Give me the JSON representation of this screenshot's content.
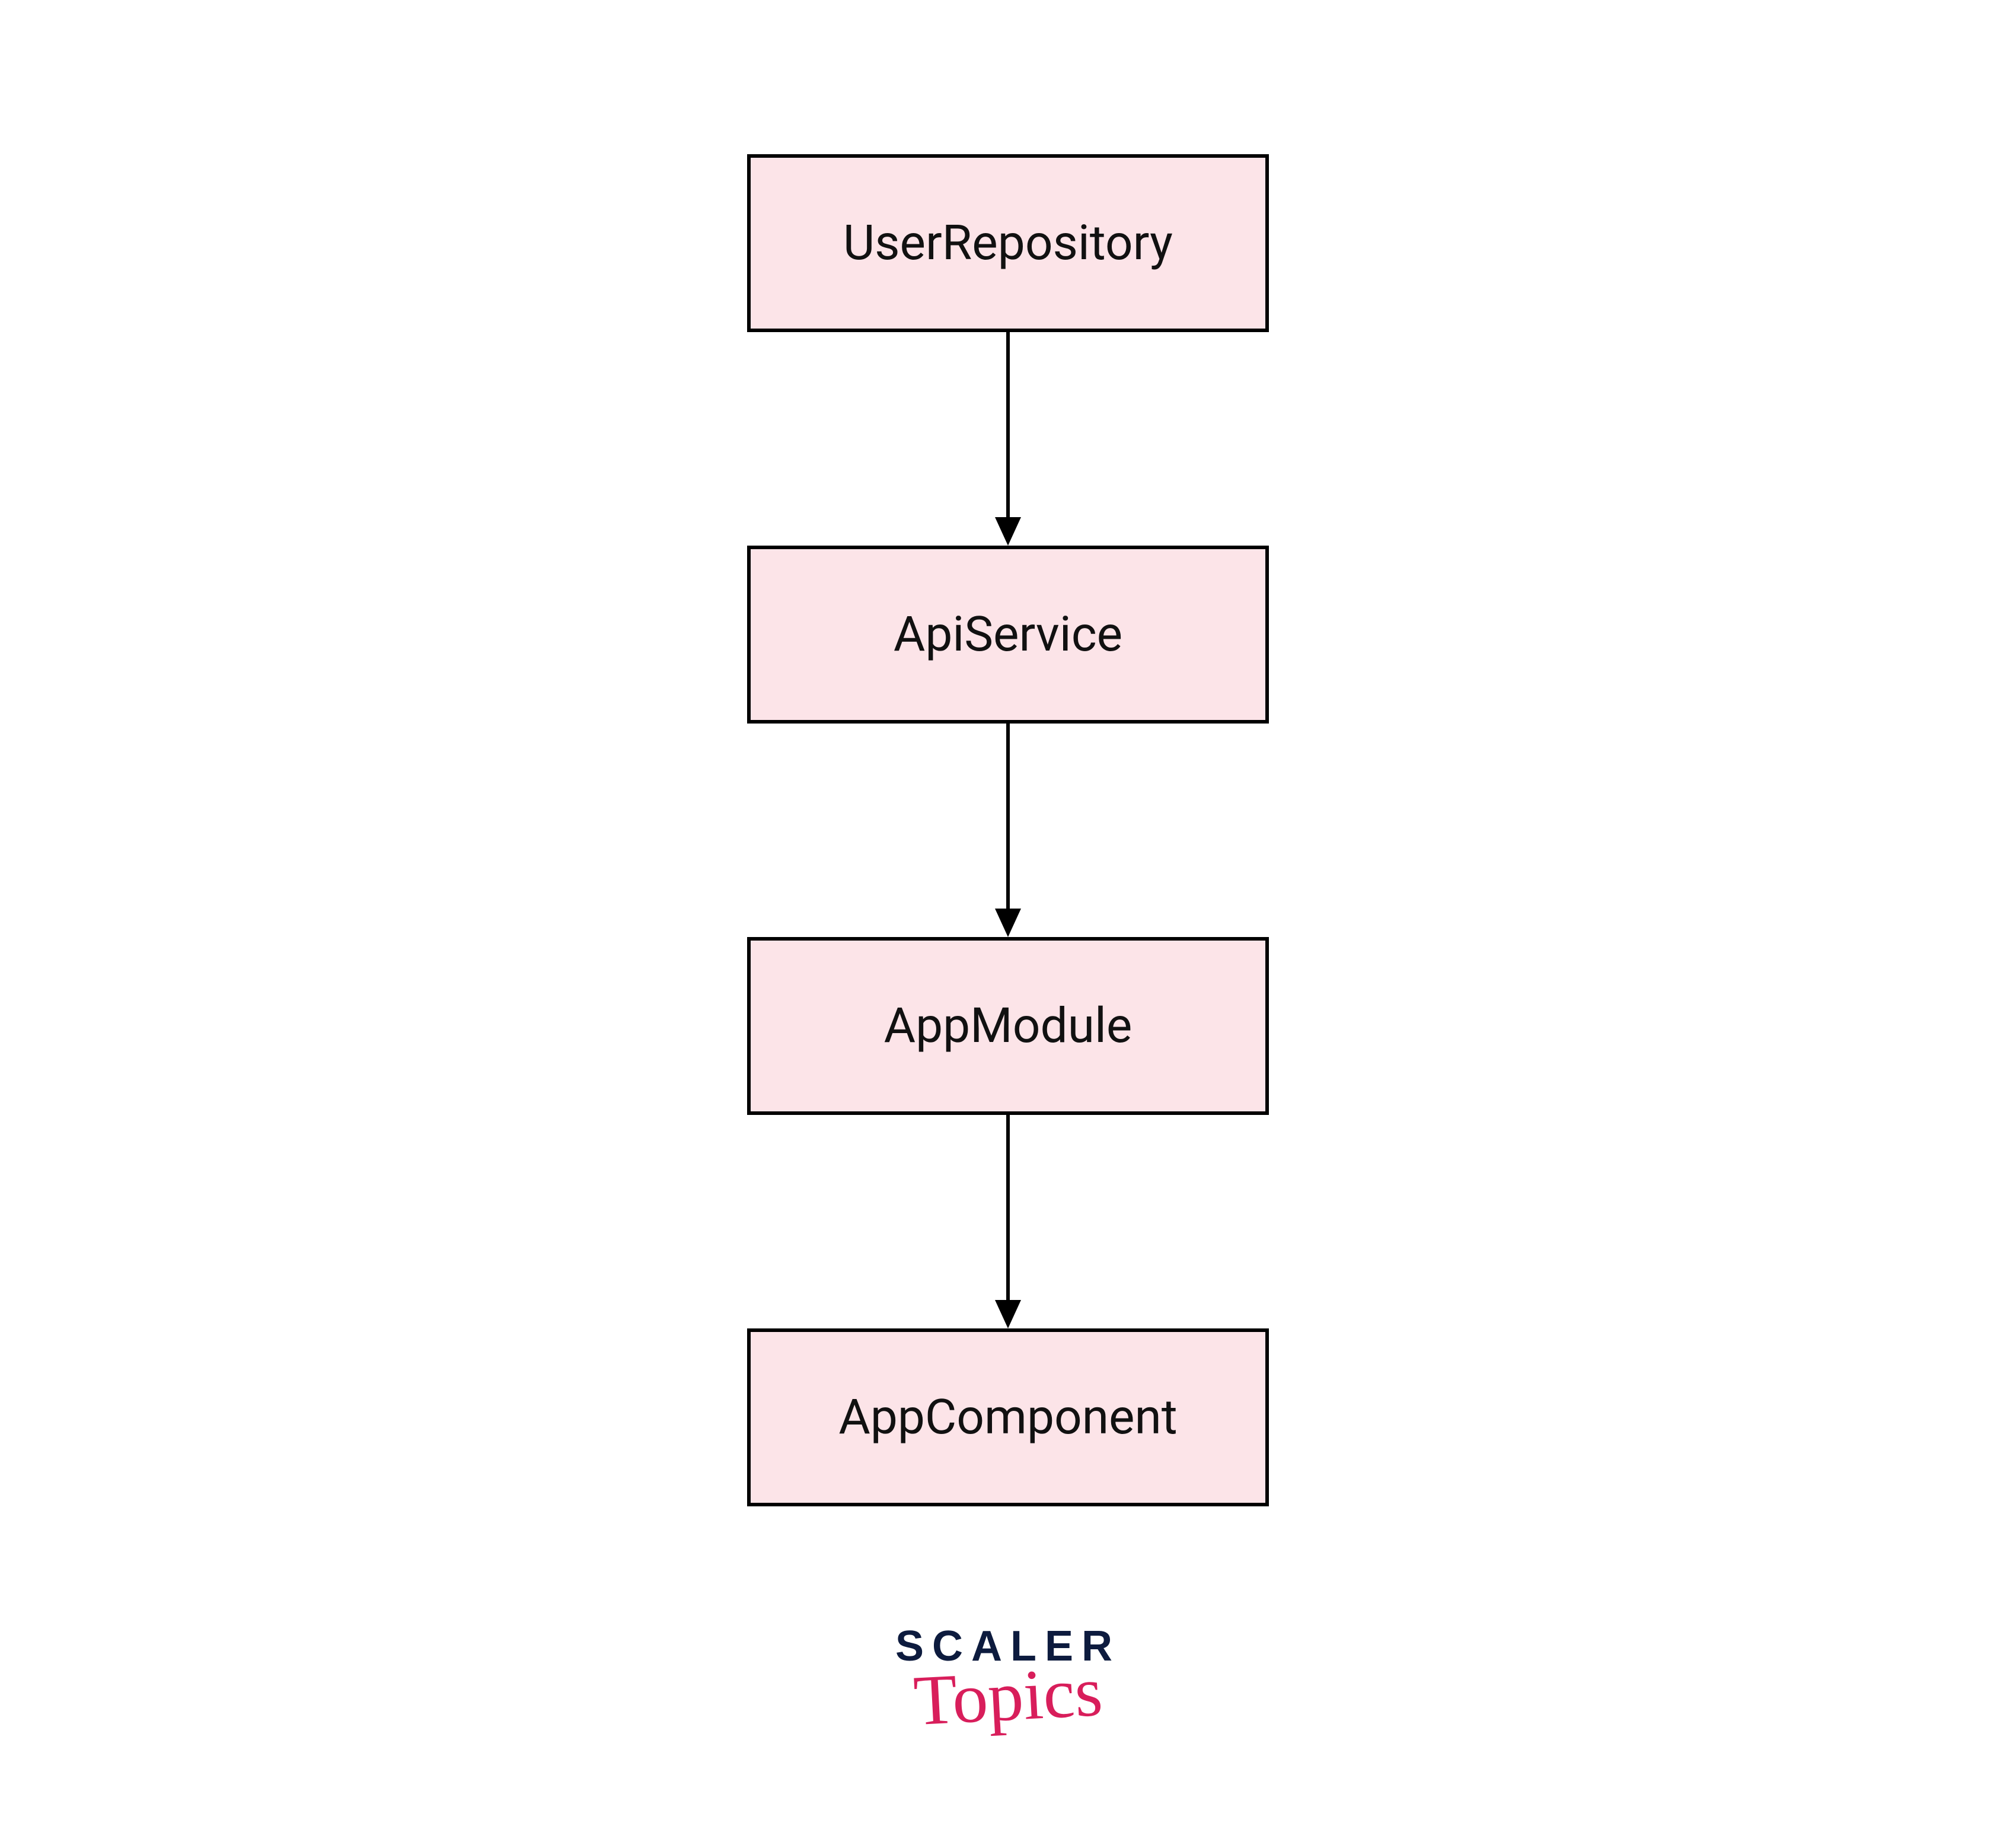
{
  "colors": {
    "node_fill": "#fce4e8",
    "node_border": "#000000",
    "arrow": "#000000",
    "logo_primary": "#0d1b3e",
    "logo_accent": "#d81e5b"
  },
  "diagram": {
    "nodes": [
      {
        "id": "user-repository",
        "label": "UserRepository"
      },
      {
        "id": "api-service",
        "label": "ApiService"
      },
      {
        "id": "app-module",
        "label": "AppModule"
      },
      {
        "id": "app-component",
        "label": "AppComponent"
      }
    ],
    "edges": [
      {
        "from": "user-repository",
        "to": "api-service"
      },
      {
        "from": "api-service",
        "to": "app-module"
      },
      {
        "from": "app-module",
        "to": "app-component"
      }
    ]
  },
  "branding": {
    "line1": "SCALER",
    "line2": "Topics"
  }
}
